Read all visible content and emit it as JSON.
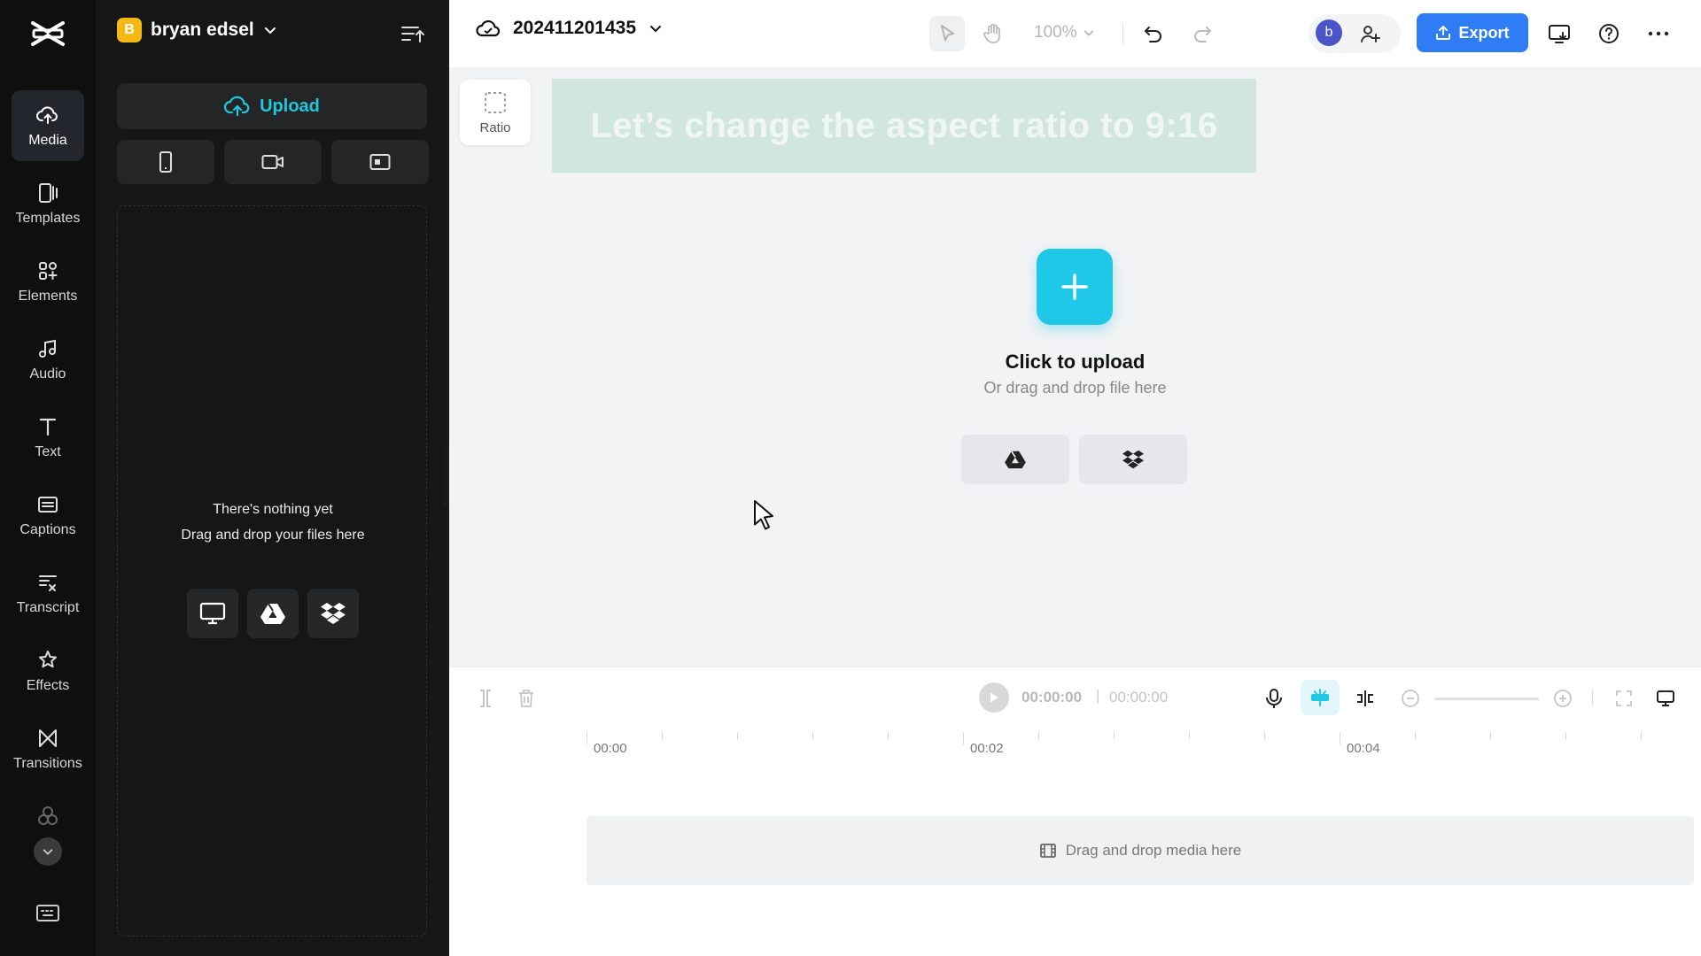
{
  "app": {
    "brand_color": "#1ec8e6",
    "export_color": "#2e7cf6"
  },
  "rail": {
    "items": [
      {
        "label": "Media",
        "icon": "cloud-upload-icon",
        "active": true
      },
      {
        "label": "Templates",
        "icon": "templates-icon"
      },
      {
        "label": "Elements",
        "icon": "elements-icon"
      },
      {
        "label": "Audio",
        "icon": "music-note-icon"
      },
      {
        "label": "Text",
        "icon": "text-icon"
      },
      {
        "label": "Captions",
        "icon": "captions-icon"
      },
      {
        "label": "Transcript",
        "icon": "transcript-icon"
      },
      {
        "label": "Effects",
        "icon": "effects-icon"
      },
      {
        "label": "Transitions",
        "icon": "transitions-icon"
      }
    ]
  },
  "panel": {
    "account_initial": "B",
    "account_name": "bryan edsel",
    "upload_label": "Upload",
    "empty_line1": "There's nothing yet",
    "empty_line2": "Drag and drop your files here"
  },
  "topbar": {
    "project_name": "202411201435",
    "zoom": "100%",
    "avatar_initial": "b",
    "export_label": "Export"
  },
  "canvas": {
    "ratio_label": "Ratio",
    "caption_overlay": "Let’s change the aspect ratio to 9:16",
    "upload_title": "Click to upload",
    "upload_subtitle": "Or drag and drop file here"
  },
  "timeline": {
    "current_time": "00:00:00",
    "separator": "|",
    "total_time": "00:00:00",
    "ruler": [
      "00:00",
      "00:02",
      "00:04"
    ],
    "drop_label": "Drag and drop media here"
  }
}
